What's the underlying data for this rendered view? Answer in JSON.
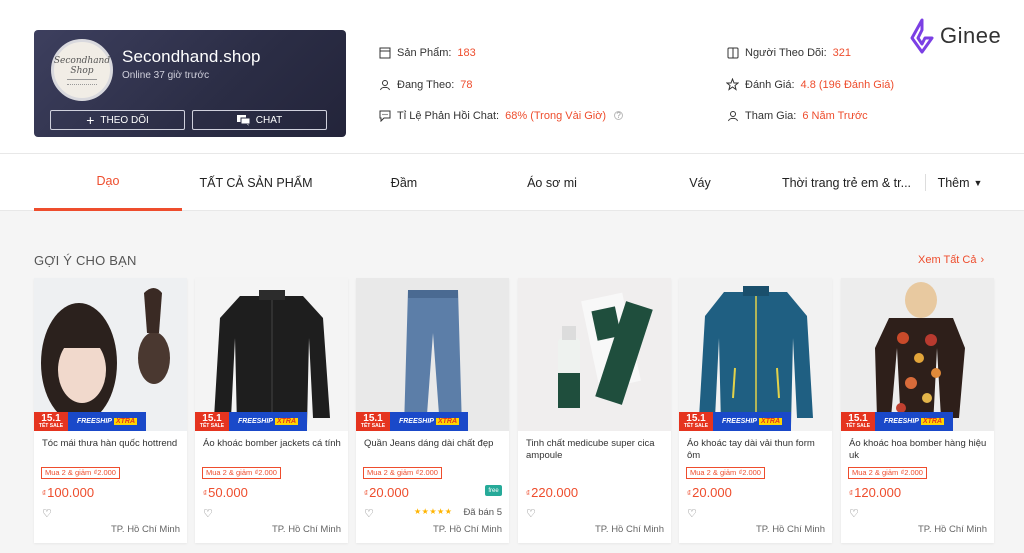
{
  "shop": {
    "name": "Secondhand.shop",
    "online": "Online 37 giờ trước",
    "avatar_text": "Secondhand Shop",
    "follow_label": "THEO DÕI",
    "chat_label": "CHAT"
  },
  "stats": {
    "products_label": "Sản Phẩm:",
    "products_value": "183",
    "following_label": "Đang Theo:",
    "following_value": "78",
    "response_label": "Tỉ Lệ Phản Hồi Chat:",
    "response_value": "68% (Trong Vài Giờ)",
    "followers_label": "Người Theo Dõi:",
    "followers_value": "321",
    "rating_label": "Đánh Giá:",
    "rating_value": "4.8 (196 Đánh Giá)",
    "joined_label": "Tham Gia:",
    "joined_value": "6 Năm Trước"
  },
  "brand": {
    "name": "Ginee",
    "color": "#7b3fe4"
  },
  "tabs": [
    {
      "label": "Dạo",
      "active": true
    },
    {
      "label": "TẤT CẢ SẢN PHẨM",
      "active": false
    },
    {
      "label": "Đầm",
      "active": false
    },
    {
      "label": "Áo sơ mi",
      "active": false
    },
    {
      "label": "Váy",
      "active": false
    },
    {
      "label": "Thời trang trẻ em & tr...",
      "active": false
    },
    {
      "label": "Thêm",
      "active": false
    }
  ],
  "section": {
    "title": "GỢI Ý CHO BẠN",
    "see_all": "Xem Tất Cả"
  },
  "promo": {
    "date": "15.1",
    "date_sub": "TẾT SALE",
    "ship": "FREESHIP",
    "ship_badge": "XTRA"
  },
  "colors": {
    "accent": "#ee4d2d"
  },
  "products": [
    {
      "name": "Tóc mái thưa hàn quốc hottrend",
      "deal": "Mua 2 & giảm ₫2.000",
      "currency": "₫",
      "price": "100.000",
      "location": "TP. Hồ Chí Minh"
    },
    {
      "name": "Áo khoác bomber jackets cá tính",
      "deal": "Mua 2 & giảm ₫2.000",
      "currency": "₫",
      "price": "50.000",
      "location": "TP. Hồ Chí Minh"
    },
    {
      "name": "Quần Jeans dáng dài chất đẹp",
      "deal": "Mua 2 & giảm ₫2.000",
      "currency": "₫",
      "price": "20.000",
      "location": "TP. Hồ Chí Minh",
      "rating": 5,
      "sold": "Đã bán 5",
      "free_icon": "free"
    },
    {
      "name": "Tinh chất medicube super cica ampoule",
      "currency": "₫",
      "price": "220.000",
      "location": "TP. Hồ Chí Minh"
    },
    {
      "name": "Áo khoác tay dài vải thun form ôm",
      "deal": "Mua 2 & giảm ₫2.000",
      "currency": "₫",
      "price": "20.000",
      "location": "TP. Hồ Chí Minh"
    },
    {
      "name": "Áo khoác hoa bomber hàng hiệu uk",
      "deal": "Mua 2 & giảm ₫2.000",
      "currency": "₫",
      "price": "120.000",
      "location": "TP. Hồ Chí Minh"
    }
  ]
}
